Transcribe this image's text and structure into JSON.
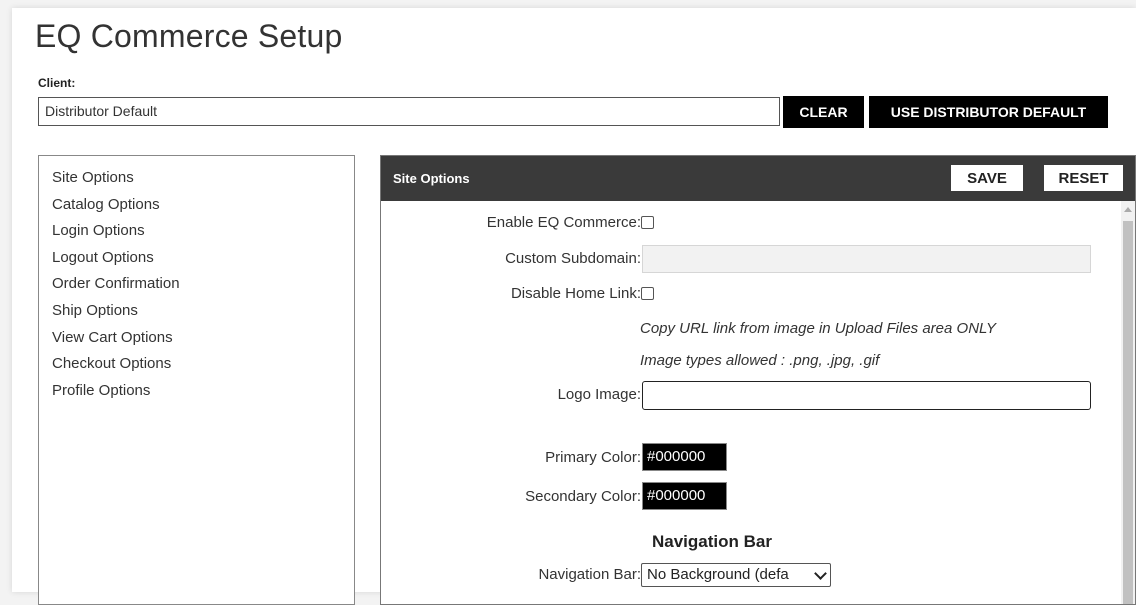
{
  "page": {
    "title": "EQ Commerce Setup"
  },
  "client": {
    "label": "Client:",
    "value": "Distributor Default",
    "clear_label": "CLEAR",
    "use_default_label": "USE DISTRIBUTOR DEFAULT"
  },
  "sidebar": {
    "items": [
      {
        "label": "Site Options"
      },
      {
        "label": "Catalog Options"
      },
      {
        "label": "Login Options"
      },
      {
        "label": "Logout Options"
      },
      {
        "label": "Order Confirmation"
      },
      {
        "label": "Ship Options"
      },
      {
        "label": "View Cart Options"
      },
      {
        "label": "Checkout Options"
      },
      {
        "label": "Profile Options"
      }
    ]
  },
  "panel": {
    "title": "Site Options",
    "save_label": "SAVE",
    "reset_label": "RESET",
    "fields": {
      "enable_commerce": {
        "label": "Enable EQ Commerce:",
        "checked": false
      },
      "custom_subdomain": {
        "label": "Custom Subdomain:",
        "value": ""
      },
      "disable_home_link": {
        "label": "Disable Home Link:",
        "checked": false
      },
      "logo_help_1": "Copy URL link from image in Upload Files area ONLY",
      "logo_help_2": "Image types allowed : .png, .jpg, .gif",
      "logo_image": {
        "label": "Logo Image:",
        "value": ""
      },
      "primary_color": {
        "label": "Primary Color:",
        "value": "#000000"
      },
      "secondary_color": {
        "label": "Secondary Color:",
        "value": "#000000"
      },
      "nav_heading": "Navigation Bar",
      "navigation_bar": {
        "label": "Navigation Bar:",
        "selected": "No Background (defa"
      }
    }
  },
  "colors": {
    "header_bg": "#3a3a3a",
    "button_bg": "#000000",
    "swatch_bg": "#000000"
  }
}
